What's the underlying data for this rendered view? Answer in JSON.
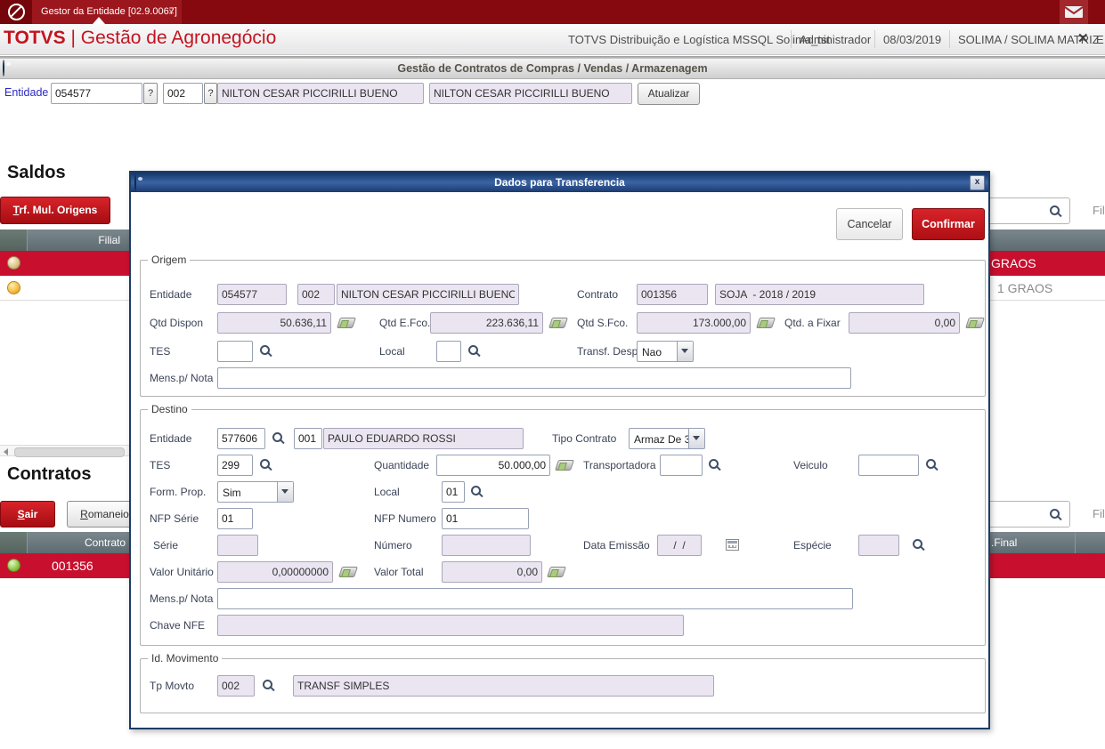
{
  "window": {
    "tab_title": "Gestor da Entidade [02.9.0067]",
    "tab_close": "×"
  },
  "appbar": {
    "brand_name": "TOTVS",
    "brand_app": "| Gestão de Agronegócio",
    "environment": "TOTVS Distribuição e Logística MSSQL Solima_tst",
    "user": "Administrador",
    "date": "08/03/2019",
    "company": "SOLIMA / SOLIMA MATRIZ",
    "close_fragment": "E"
  },
  "panel": {
    "title": "Gestão de Contratos de Compras / Vendas / Armazenagem",
    "entity": {
      "label": "Entidade",
      "code": "054577",
      "help1": "?",
      "loja": "002",
      "help2": "?",
      "name1": "NILTON CESAR PICCIRILLI BUENO",
      "name2": "NILTON CESAR PICCIRILLI BUENO",
      "refresh": "Atualizar"
    }
  },
  "saldos": {
    "heading": "Saldos",
    "trf_button": "Trf. Mul. Origens",
    "search_value": "",
    "filter_fragment": "Fil",
    "header_col": "Filial",
    "rows": [
      {
        "fragment": "GRAOS"
      },
      {
        "fragment": "1 GRAOS"
      }
    ]
  },
  "contratos": {
    "heading": "Contratos",
    "exit_button": "Sair",
    "romaneio_button": "Romaneio",
    "search_value": "",
    "filter_fragment": "Fil",
    "header_col": "Contrato",
    "header_col_fragment": ".Final",
    "rows": [
      {
        "contract": "001356"
      }
    ]
  },
  "modal": {
    "title": "Dados para Transferencia",
    "close": "x",
    "cancel": "Cancelar",
    "confirm": "Confirmar",
    "origem": {
      "legend": "Origem",
      "entidade_label": "Entidade",
      "entidade_code": "054577",
      "entidade_loja": "002",
      "entidade_nome": "NILTON CESAR PICCIRILLI BUENO",
      "contrato_label": "Contrato",
      "contrato_code": "001356",
      "contrato_desc": "SOJA  - 2018 / 2019",
      "qtd_dispon_label": "Qtd Dispon",
      "qtd_dispon": "50.636,11",
      "qtd_efco_label": "Qtd E.Fco.",
      "qtd_efco": "223.636,11",
      "qtd_sfco_label": "Qtd S.Fco.",
      "qtd_sfco": "173.000,00",
      "qtd_fixar_label": "Qtd. a Fixar",
      "qtd_fixar": "0,00",
      "tes_label": "TES",
      "tes": "",
      "local_label": "Local",
      "local": "",
      "transf_despesa_label": "Transf. Despesa",
      "transf_despesa": "Nao",
      "mens_label": "Mens.p/ Nota",
      "mens": ""
    },
    "destino": {
      "legend": "Destino",
      "entidade_label": "Entidade",
      "entidade_code": "577606",
      "entidade_loja": "001",
      "entidade_nome": "PAULO EDUARDO ROSSI",
      "tipo_contrato_label": "Tipo Contrato",
      "tipo_contrato": "Armaz De 3",
      "tes_label": "TES",
      "tes": "299",
      "quantidade_label": "Quantidade",
      "quantidade": "50.000,00",
      "transportadora_label": "Transportadora",
      "transportadora": "",
      "veiculo_label": "Veiculo",
      "veiculo": "",
      "form_prop_label": "Form. Prop.",
      "form_prop": "Sim",
      "local_label": "Local",
      "local": "01",
      "nfp_serie_label": "NFP Série",
      "nfp_serie": "01",
      "nfp_numero_label": "NFP Numero",
      "nfp_numero": "01",
      "serie_label": "Série",
      "serie": "",
      "numero_label": "Número",
      "numero": "",
      "data_emissao_label": "Data Emissão",
      "data_emissao": "/  /",
      "especie_label": "Espécie",
      "especie": "",
      "valor_unitario_label": "Valor Unitário",
      "valor_unitario": "0,00000000",
      "valor_total_label": "Valor Total",
      "valor_total": "0,00",
      "mens_label": "Mens.p/ Nota",
      "mens": "",
      "chave_label": "Chave NFE",
      "chave": ""
    },
    "movimento": {
      "legend": "Id. Movimento",
      "tp_movto_label": "Tp Movto",
      "tp_movto": "002",
      "tp_movto_desc": "TRANSF SIMPLES"
    }
  }
}
